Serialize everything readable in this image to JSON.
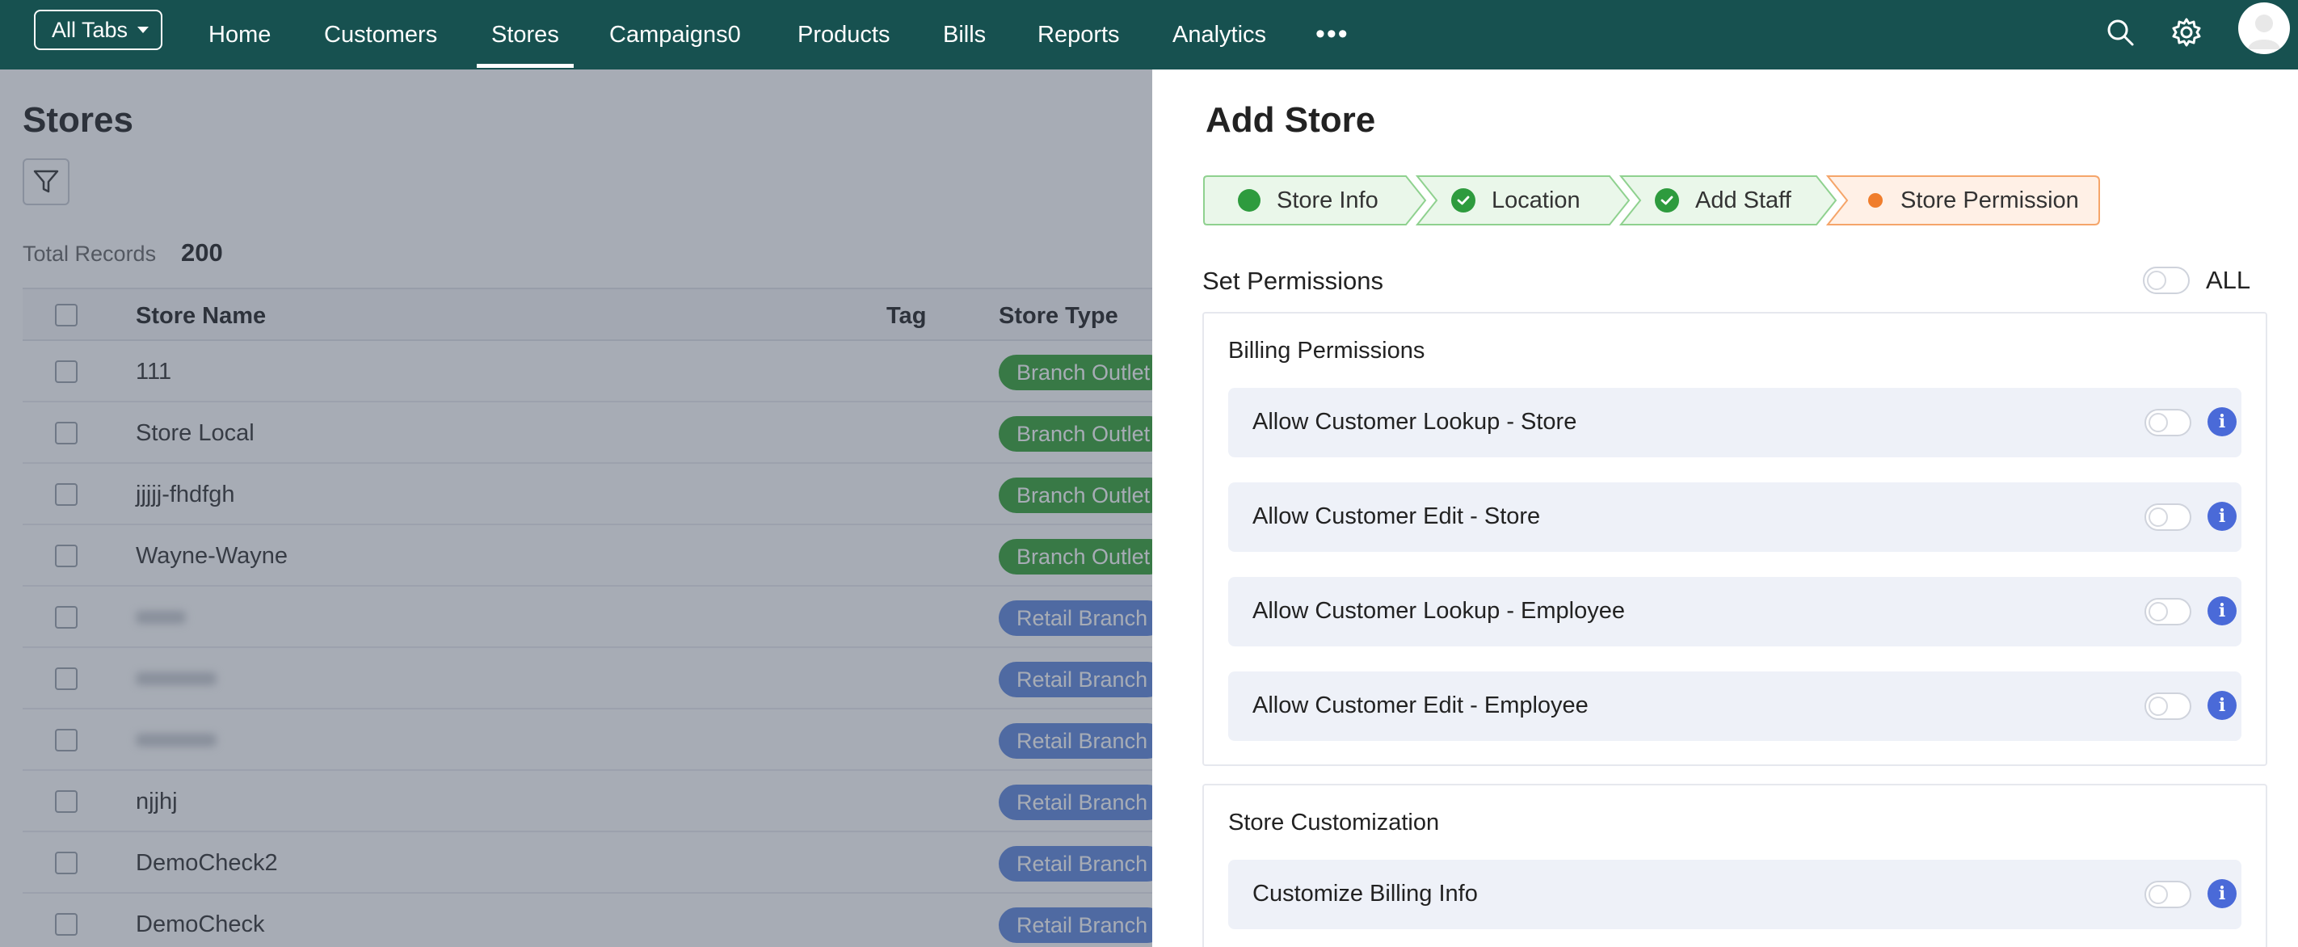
{
  "nav": {
    "all_tabs_label": "All Tabs",
    "items": [
      {
        "label": "Home"
      },
      {
        "label": "Customers"
      },
      {
        "label": "Stores"
      },
      {
        "label": "Campaigns0"
      },
      {
        "label": "Products"
      },
      {
        "label": "Bills"
      },
      {
        "label": "Reports"
      },
      {
        "label": "Analytics"
      }
    ],
    "active": "Stores",
    "more_label": "•••",
    "icons": [
      "search-icon",
      "gear-icon",
      "avatar"
    ]
  },
  "stores": {
    "title": "Stores",
    "total_label": "Total Records",
    "total_value": "200",
    "columns": [
      "Store Name",
      "Tag",
      "Store Type"
    ],
    "rows": [
      {
        "name": "111",
        "type": "Branch Outlet"
      },
      {
        "name": "Store Local",
        "type": "Branch Outlet"
      },
      {
        "name": "jjjjj-fhdfgh",
        "type": "Branch Outlet"
      },
      {
        "name": "Wayne-Wayne",
        "type": "Branch Outlet"
      },
      {
        "name": "",
        "type": "Retail Branch"
      },
      {
        "name": "",
        "type": "Retail Branch"
      },
      {
        "name": "",
        "type": "Retail Branch"
      },
      {
        "name": "njjhj",
        "type": "Retail Branch"
      },
      {
        "name": "DemoCheck2",
        "type": "Retail Branch"
      },
      {
        "name": "DemoCheck",
        "type": "Retail Branch"
      }
    ]
  },
  "drawer": {
    "title": "Add Store",
    "steps": [
      {
        "label": "Store Info",
        "state": "current-done"
      },
      {
        "label": "Location",
        "state": "done"
      },
      {
        "label": "Add Staff",
        "state": "done"
      },
      {
        "label": "Store Permission",
        "state": "active"
      }
    ],
    "set_permissions_label": "Set Permissions",
    "all_label": "ALL",
    "billing": {
      "title": "Billing Permissions",
      "items": [
        {
          "label": "Allow Customer Lookup - Store",
          "enabled": false
        },
        {
          "label": "Allow Customer Edit - Store",
          "enabled": false
        },
        {
          "label": "Allow Customer Lookup - Employee",
          "enabled": false
        },
        {
          "label": "Allow Customer Edit - Employee",
          "enabled": false
        }
      ]
    },
    "customization": {
      "title": "Store Customization",
      "items": [
        {
          "label": "Customize Billing Info",
          "enabled": false
        }
      ]
    },
    "info_glyph": "i"
  },
  "colors": {
    "nav_bg": "#175150",
    "step_done_bg": "#eaf7ea",
    "step_done_border": "#8fd18f",
    "step_active_bg": "#fff0e6",
    "step_active_border": "#f5a56a",
    "branch_outlet": "#35a335",
    "retail_branch": "#5f88dd",
    "info_icon": "#4a6ad8"
  }
}
